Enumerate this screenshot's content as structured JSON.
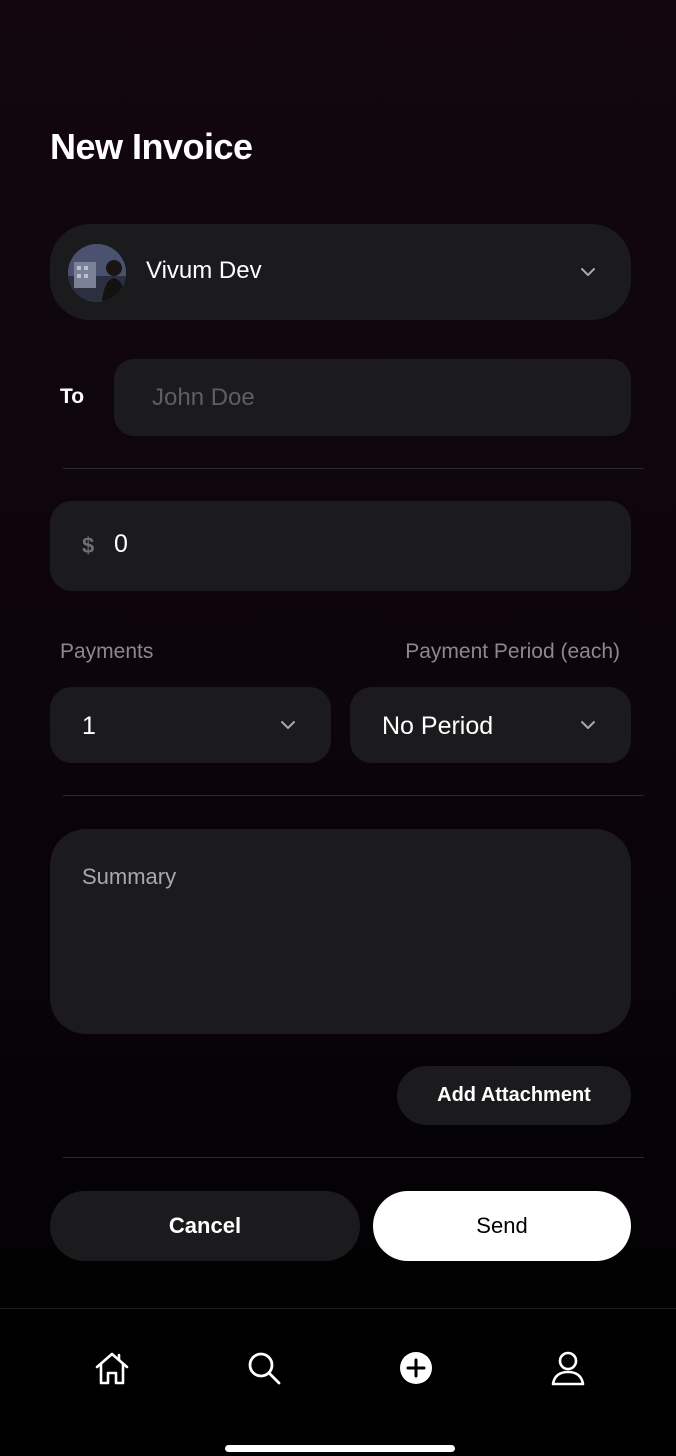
{
  "header": {
    "title": "New Invoice"
  },
  "account": {
    "name": "Vivum Dev",
    "avatar_icon": "user-photo"
  },
  "recipient": {
    "label": "To",
    "placeholder": "John Doe",
    "value": ""
  },
  "amount": {
    "currency_symbol": "$",
    "value": "0"
  },
  "payments": {
    "count_label": "Payments",
    "count_value": "1",
    "period_label": "Payment Period (each)",
    "period_value": "No Period"
  },
  "summary": {
    "placeholder": "Summary"
  },
  "actions": {
    "add_attachment": "Add Attachment",
    "cancel": "Cancel",
    "send": "Send"
  },
  "nav": {
    "items": [
      {
        "icon": "home-icon"
      },
      {
        "icon": "search-icon"
      },
      {
        "icon": "add-circle-icon"
      },
      {
        "icon": "profile-icon"
      }
    ]
  },
  "colors": {
    "surface": "#1b1a1d",
    "primary_button": "#ffffff",
    "placeholder": "#5f5e63"
  }
}
